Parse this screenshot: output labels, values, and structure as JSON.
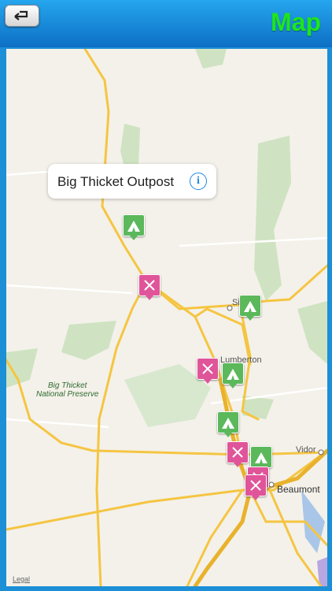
{
  "header": {
    "title": "Map",
    "back_icon": "back-arrow-icon"
  },
  "callout": {
    "title": "Big Thicket Outpost",
    "info_icon": "info-icon",
    "info_glyph": "i"
  },
  "places": {
    "lumberton": "Lumberton",
    "silsbee_partial": "Si",
    "vidor": "Vidor",
    "beaumont": "Beaumont"
  },
  "park": {
    "name_line1": "Big Thicket",
    "name_line2": "National Preserve"
  },
  "legal": "Legal",
  "pins": [
    {
      "type": "camp",
      "icon": "tent-icon"
    },
    {
      "type": "food",
      "icon": "fork-knife-icon"
    },
    {
      "type": "camp",
      "icon": "tent-icon"
    },
    {
      "type": "food",
      "icon": "fork-knife-icon"
    },
    {
      "type": "camp",
      "icon": "tent-icon"
    },
    {
      "type": "camp",
      "icon": "tent-icon"
    },
    {
      "type": "food",
      "icon": "fork-knife-icon"
    },
    {
      "type": "camp",
      "icon": "tent-icon"
    },
    {
      "type": "food",
      "icon": "fork-knife-icon"
    },
    {
      "type": "food",
      "icon": "fork-knife-icon"
    }
  ],
  "colors": {
    "header": "#1c8fd6",
    "title": "#1ee61a",
    "camp": "#5bb85b",
    "food": "#e0559a",
    "road": "#f5c542"
  }
}
